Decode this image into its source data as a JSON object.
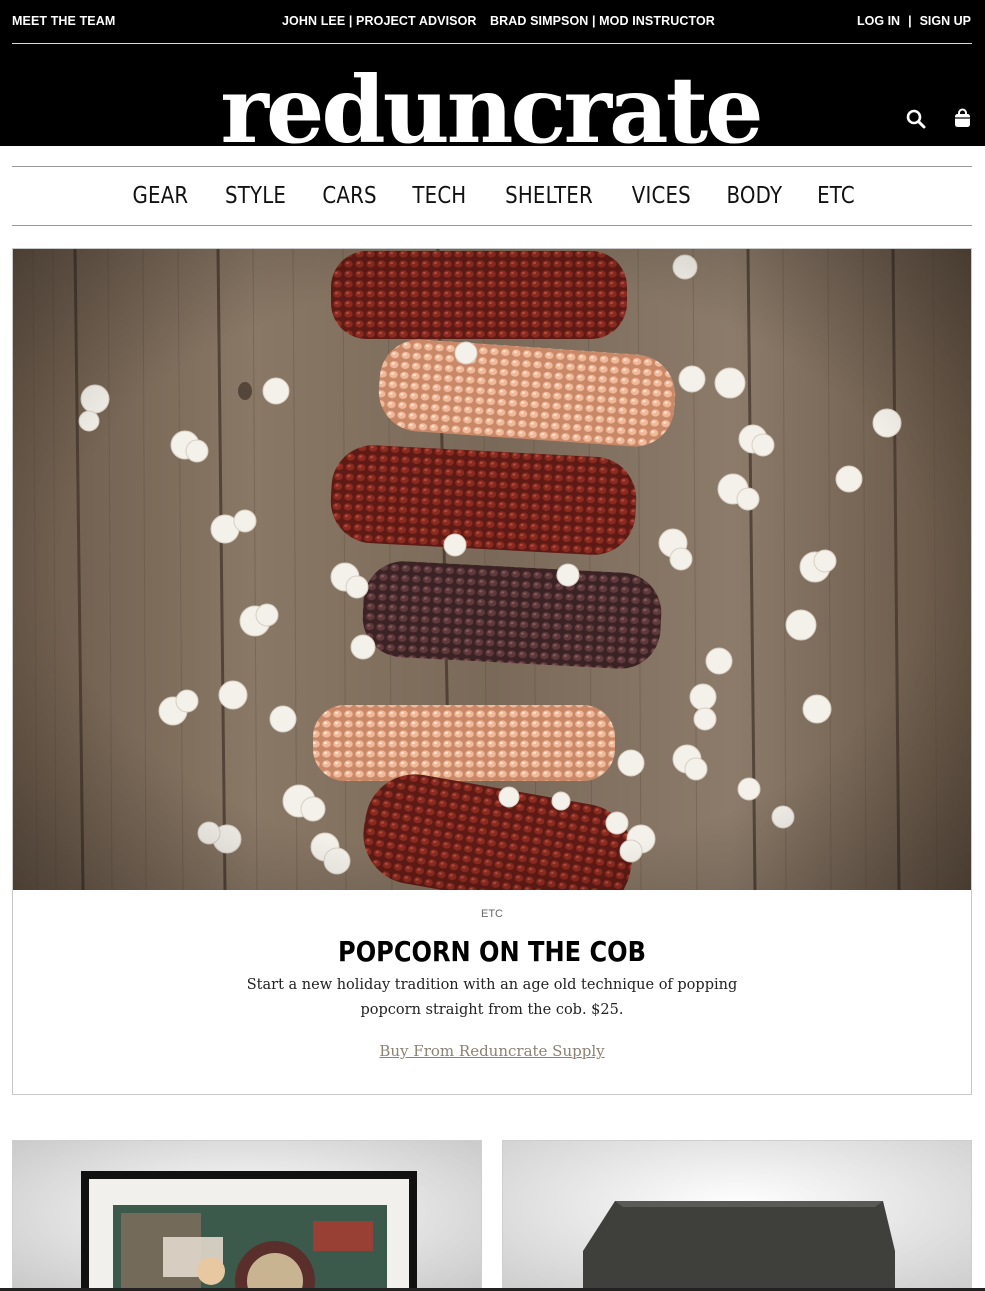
{
  "utility_nav": {
    "meet_team": "MEET THE TEAM",
    "advisor": "JOHN LEE | PROJECT ADVISOR",
    "instructor": "BRAD SIMPSON | MOD INSTRUCTOR",
    "login": "LOG IN",
    "separator": "|",
    "signup": "SIGN UP"
  },
  "brand": {
    "logo_text": "reduncrate"
  },
  "header_icons": [
    "search-icon",
    "shopping-bag-icon"
  ],
  "categories": [
    "GEAR",
    "STYLE",
    "CARS",
    "TECH",
    "SHELTER",
    "VICES",
    "BODY",
    "ETC"
  ],
  "featured": {
    "category": "ETC",
    "title": "POPCORN ON THE COB",
    "description": "Start a new holiday tradition with an age old technique of popping popcorn straight from the cob. $25.",
    "cta": "Buy From Reduncrate Supply"
  },
  "colors": {
    "header_bg": "#000000",
    "link_muted": "#8c8273",
    "wood": "#7b6a5a"
  }
}
